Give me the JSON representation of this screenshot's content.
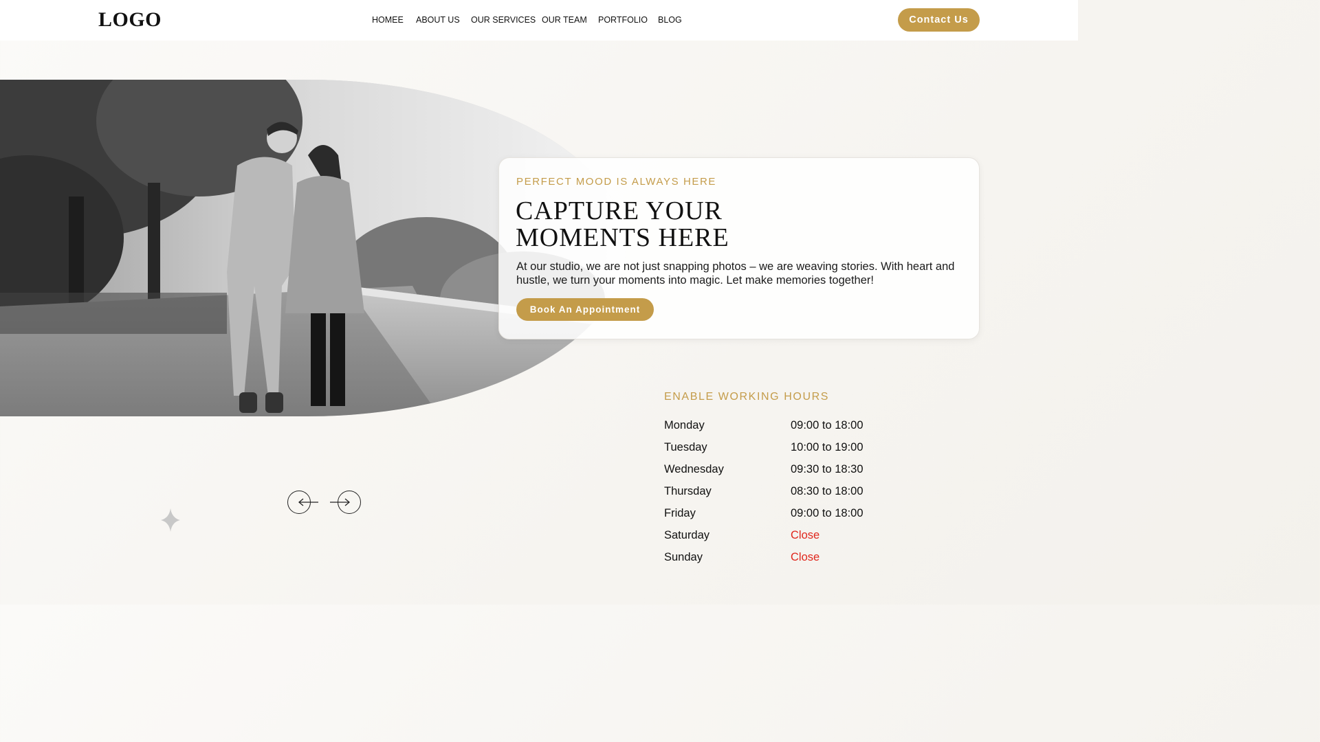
{
  "header": {
    "logo": "LOGO",
    "nav": [
      "HOMEE",
      "ABOUT US",
      "OUR SERVICES",
      "OUR TEAM",
      "PORTFOLIO",
      "BLOG"
    ],
    "contact_label": "Contact Us"
  },
  "hero": {
    "eyebrow": "PERFECT MOOD IS ALWAYS HERE",
    "headline_line1": "CAPTURE YOUR",
    "headline_line2": "MOMENTS HERE",
    "body": "At our studio, we are not just snapping photos – we are weaving stories. With heart and hustle, we turn your moments into magic. Let make memories together!",
    "cta_label": "Book An Appointment",
    "photo_icon": "couple-walking-photo"
  },
  "slider": {
    "prev_icon": "arrow-left-icon",
    "next_icon": "arrow-right-icon"
  },
  "hours": {
    "title": "ENABLE WORKING HOURS",
    "rows": [
      {
        "day": "Monday",
        "time": "09:00 to 18:00",
        "closed": false
      },
      {
        "day": "Tuesday",
        "time": "10:00 to 19:00",
        "closed": false
      },
      {
        "day": "Wednesday",
        "time": "09:30 to 18:30",
        "closed": false
      },
      {
        "day": "Thursday",
        "time": "08:30 to 18:00",
        "closed": false
      },
      {
        "day": "Friday",
        "time": "09:00 to 18:00",
        "closed": false
      },
      {
        "day": "Saturday",
        "time": "Close",
        "closed": true
      },
      {
        "day": "Sunday",
        "time": "Close",
        "closed": true
      }
    ]
  },
  "colors": {
    "accent": "#c49c4a",
    "closed": "#e0271d",
    "text": "#111111",
    "background": "#f6f4f0"
  }
}
